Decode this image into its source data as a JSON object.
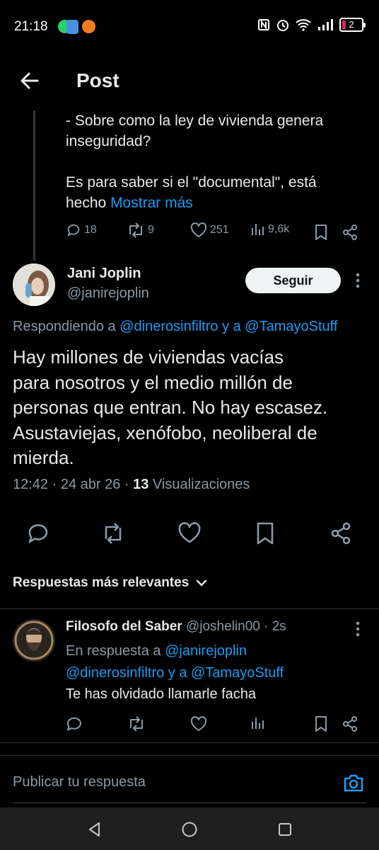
{
  "status_bar": {
    "time": "21:18",
    "battery_level": "2"
  },
  "header": {
    "title": "Post"
  },
  "previous_post": {
    "text_line1": "- Sobre como la ley de vivienda genera\ninseguridad?\n\nEs para saber si el \"documental\", está\nhecho ",
    "show_more": "Mostrar más",
    "replies": "18",
    "reposts": "9",
    "likes": "251",
    "views": "9,6k"
  },
  "post": {
    "author_name": "Jani Joplin",
    "author_handle": "@janirejoplin",
    "follow_label": "Seguir",
    "replying_prefix": "Respondiendo a ",
    "replying_to": "@dinerosinfiltro y a @TamayoStuff",
    "text": "Hay millones de viviendas vacías\npara nosotros y el medio millón de\npersonas que entran. No hay escasez.\nAsustaviejas, xenófobo, neoliberal de\nmierda.",
    "time_date": "12:42 · 24 abr 26 · ",
    "views_count": "13",
    "views_label": " Visualizaciones"
  },
  "replies_section": {
    "sort_label": "Respuestas más relevantes"
  },
  "reply": {
    "author_name": "Filosofo del Saber",
    "meta": " @joshelin00 · 2s",
    "context_prefix": "En respuesta a ",
    "context_handles": "@janirejoplin\n@dinerosinfiltro y a @TamayoStuff",
    "text": "Te has olvidado llamarle facha"
  },
  "compose": {
    "placeholder": "Publicar tu respuesta"
  },
  "colors": {
    "accent": "#1d9bf0",
    "muted": "#8b98a5",
    "text": "#e7e9ea",
    "background": "#000000"
  }
}
